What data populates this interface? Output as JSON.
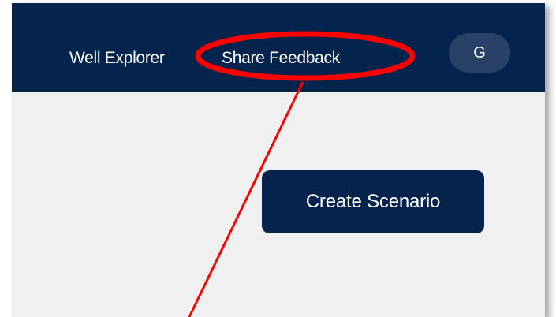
{
  "header": {
    "nav": {
      "well_explorer": "Well Explorer",
      "share_feedback": "Share Feedback"
    },
    "avatar_initial": "G"
  },
  "main": {
    "create_scenario_label": "Create Scenario"
  },
  "colors": {
    "header_bg": "#04244e",
    "content_bg": "#f0f0f0",
    "avatar_bg": "#2a4166",
    "annotation": "#ff0000"
  },
  "icons": {
    "annotation": "red-ellipse-highlight-with-pointer-line"
  }
}
